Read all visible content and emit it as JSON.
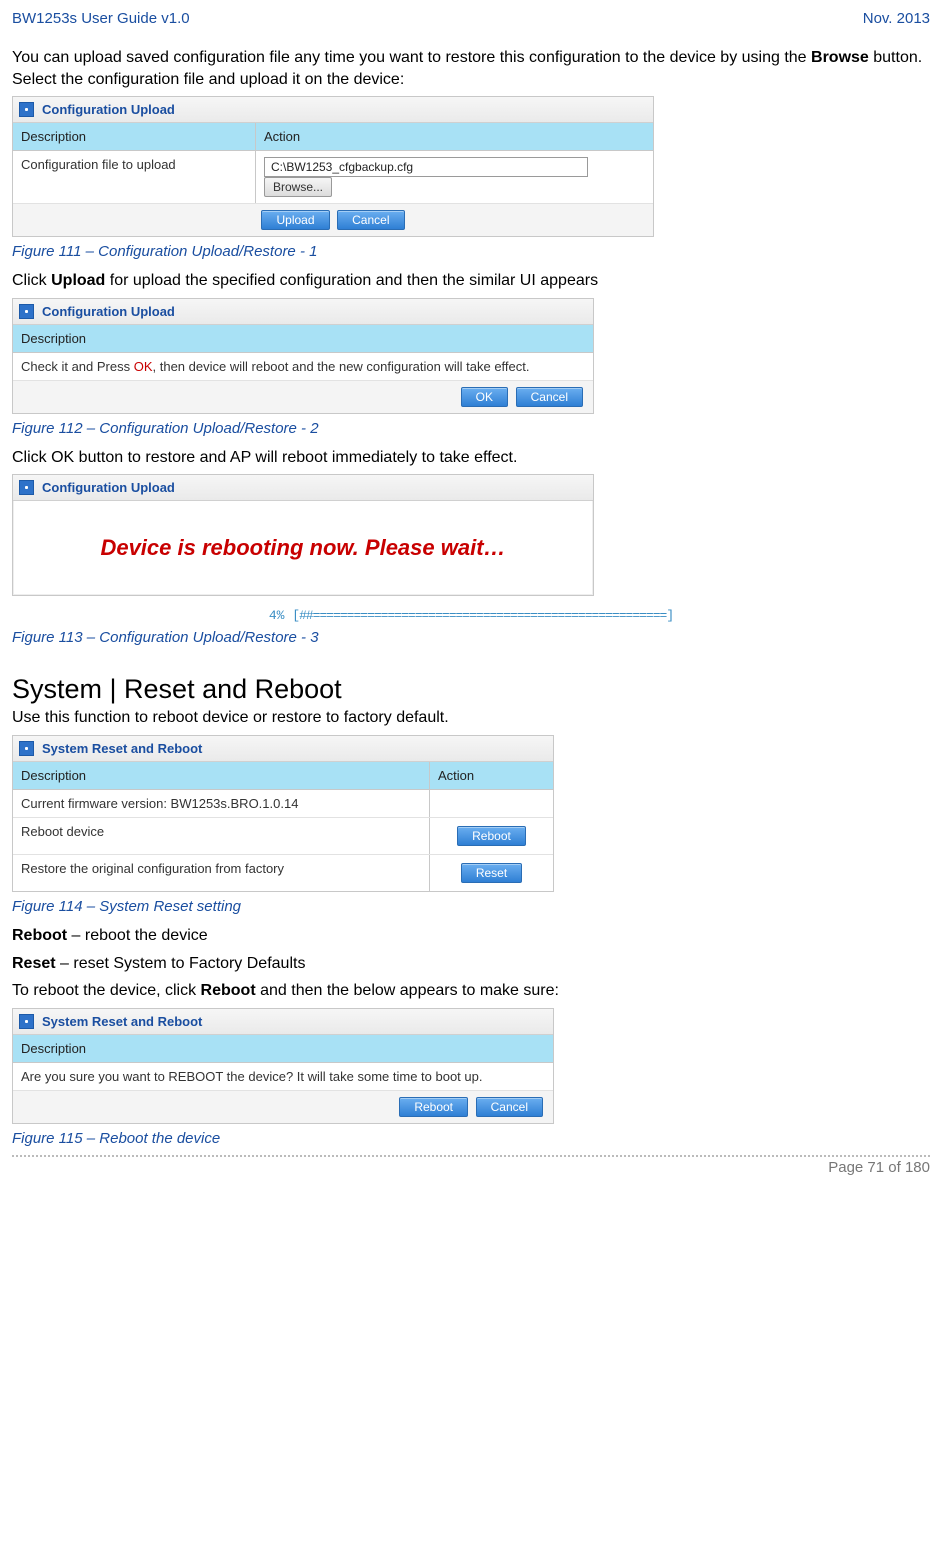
{
  "header": {
    "left": "BW1253s User Guide v1.0",
    "right": "Nov.  2013"
  },
  "intro": {
    "pre": "You can upload saved configuration file any time you want to restore this configuration to the device by using the ",
    "bold": "Browse",
    "post": " button. Select the configuration file and upload it on the device:"
  },
  "panel1": {
    "title": "Configuration Upload",
    "hdr_desc": "Description",
    "hdr_action": "Action",
    "row_label": "Configuration file to upload",
    "input_value": "C:\\BW1253_cfgbackup.cfg",
    "browse": "Browse...",
    "btn_upload": "Upload",
    "btn_cancel": "Cancel"
  },
  "caption1": "Figure 111 – Configuration Upload/Restore - 1",
  "line1": {
    "pre": "Click ",
    "bold": "Upload",
    "post": " for upload the specified configuration and then the similar UI appears"
  },
  "panel2": {
    "title": "Configuration Upload",
    "hdr_desc": "Description",
    "row_text_pre": "Check it and Press ",
    "row_text_ok": "OK",
    "row_text_post": ", then device will reboot and the new configuration will take effect.",
    "btn_ok": "OK",
    "btn_cancel": "Cancel"
  },
  "caption2": "Figure 112 – Configuration Upload/Restore - 2",
  "line2": "Click OK button to restore and AP will reboot immediately to take effect.",
  "panel3": {
    "title": "Configuration Upload",
    "msg": "Device is rebooting now. Please wait…",
    "progress_pct": "4%",
    "progress_bar": "[##====================================================]"
  },
  "caption3": "Figure 113 – Configuration Upload/Restore - 3",
  "section": "System | Reset and Reboot",
  "section_sub": "Use this function to reboot device or restore to factory default.",
  "panel4": {
    "title": "System Reset and Reboot",
    "hdr_desc": "Description",
    "hdr_action": "Action",
    "row1": "Current firmware version: BW1253s.BRO.1.0.14",
    "row2": "Reboot device",
    "row3": "Restore the original configuration from factory",
    "btn_reboot": "Reboot",
    "btn_reset": "Reset"
  },
  "caption4": "Figure 114 – System Reset setting",
  "def1": {
    "bold": "Reboot",
    "text": " – reboot the device"
  },
  "def2": {
    "bold": "Reset",
    "text": " – reset System to Factory Defaults"
  },
  "line3": {
    "pre": "To reboot the device, click ",
    "bold": "Reboot",
    "post": " and then the below appears to make sure:"
  },
  "panel5": {
    "title": "System Reset and Reboot",
    "hdr_desc": "Description",
    "row_text": "Are you sure you want to REBOOT the device? It will take some time to boot up.",
    "btn_reboot": "Reboot",
    "btn_cancel": "Cancel"
  },
  "caption5": "Figure 115 – Reboot the device",
  "footer": "Page 71 of 180"
}
